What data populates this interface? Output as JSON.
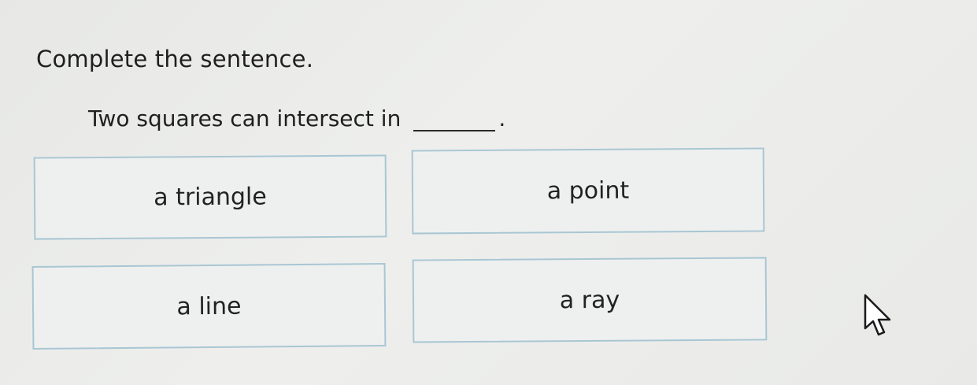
{
  "prompt": {
    "instruction": "Complete the sentence.",
    "sentence": "Two squares can intersect in",
    "period": "."
  },
  "choices": [
    {
      "label": "a triangle"
    },
    {
      "label": "a point"
    },
    {
      "label": "a line"
    },
    {
      "label": "a ray"
    }
  ],
  "colors": {
    "choice_border": "#a9c6d3",
    "background": "#eceeec"
  },
  "icons": {
    "pointer": "mouse-pointer-icon"
  }
}
